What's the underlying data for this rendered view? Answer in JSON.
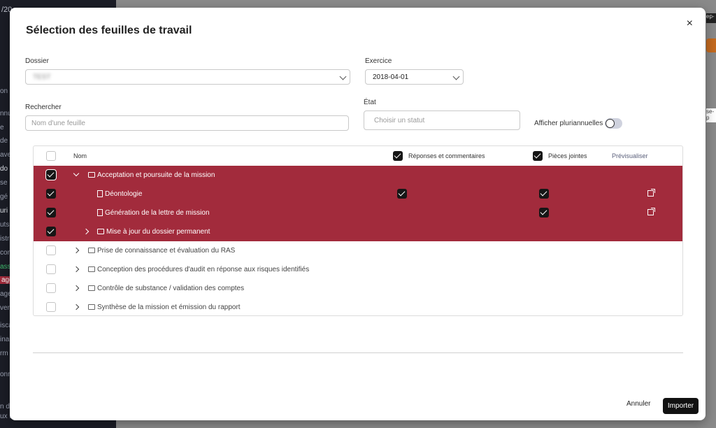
{
  "background": {
    "left_fragments": [
      "/20",
      "on e",
      "nnu",
      "e",
      "de",
      "ave",
      "do",
      "se",
      "gé",
      "uri",
      "uts",
      "istr",
      "con",
      "ass",
      "age",
      "age",
      "ver",
      "isca",
      "ina",
      "rm",
      "onn",
      "n d",
      "ux r"
    ],
    "right_fragments": [
      "ep-",
      "se-p"
    ]
  },
  "modal": {
    "title": "Sélection des feuilles de travail",
    "close_label": "×",
    "dossier": {
      "label": "Dossier",
      "value": "TEST"
    },
    "exercice": {
      "label": "Exercice",
      "value": "2018-04-01"
    },
    "search": {
      "label": "Rechercher",
      "placeholder": "Nom d'une feuille"
    },
    "etat": {
      "label": "État",
      "placeholder": "Choisir un statut"
    },
    "toggle": {
      "label": "Afficher pluriannuelles",
      "on": false
    },
    "table": {
      "headers": {
        "nom": "Nom",
        "reponses": "Réponses et commentaires",
        "pieces": "Pièces jointes",
        "preview": "Prévisualiser"
      },
      "rows": [
        {
          "label": "Acceptation et poursuite de la mission",
          "type": "folder",
          "selected": true,
          "expanded": true
        },
        {
          "label": "Déontologie",
          "type": "file",
          "selected": true
        },
        {
          "label": "Génération de la lettre de mission",
          "type": "file",
          "selected": true
        },
        {
          "label": "Mise à jour du dossier permanent",
          "type": "folder",
          "selected": true,
          "expanded": false
        },
        {
          "label": "Prise de connaissance et évaluation du RAS",
          "type": "folder",
          "selected": false
        },
        {
          "label": "Conception des procédures d'audit en réponse aux risques identifiés",
          "type": "folder",
          "selected": false
        },
        {
          "label": "Contrôle de substance / validation des comptes",
          "type": "folder",
          "selected": false
        },
        {
          "label": "Synthèse de la mission et émission du rapport",
          "type": "folder",
          "selected": false
        }
      ]
    },
    "cancel_label": "Annuler",
    "import_label": "Importer"
  },
  "colors": {
    "selected_row": "#a22b3c",
    "checkbox": "#161616",
    "primary_button": "#111111"
  }
}
